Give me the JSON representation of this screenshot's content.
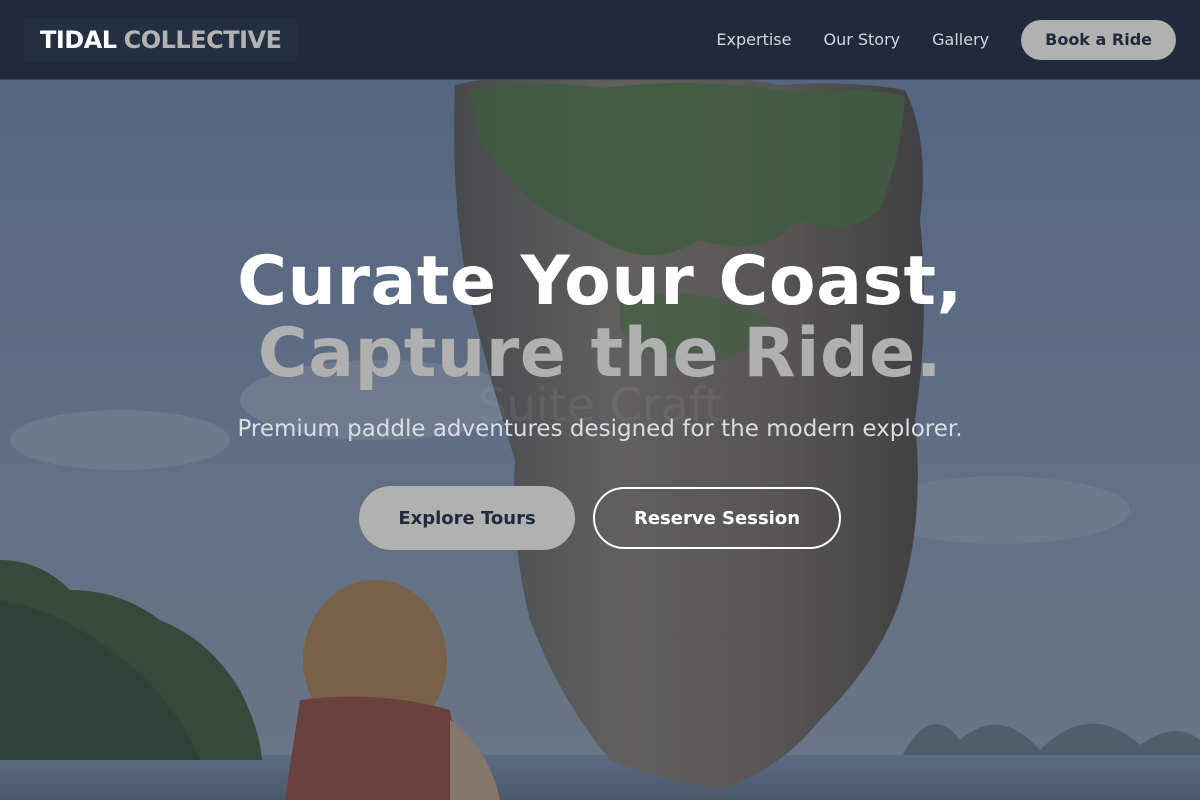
{
  "brand": {
    "name_strong": "TIDAL",
    "name_light": "COLLECTIVE"
  },
  "nav": {
    "links": [
      "Expertise",
      "Our Story",
      "Gallery"
    ],
    "cta_label": "Book a Ride"
  },
  "hero": {
    "headline_line1": "Curate Your Coast,",
    "headline_line2": "Capture the Ride.",
    "ghost_text": "Suite Craft",
    "subheadline": "Premium paddle adventures designed for the modern explorer.",
    "primary_cta": "Explore Tours",
    "secondary_cta": "Reserve Session",
    "background_image": "limestone-sea-stack-with-explorer"
  },
  "colors": {
    "nav_background": "#202a3c",
    "button_fill": "#b1b1b1",
    "button_text": "#1f2a3c",
    "headline_primary": "#ffffff",
    "headline_secondary": "#b0b0b0"
  }
}
